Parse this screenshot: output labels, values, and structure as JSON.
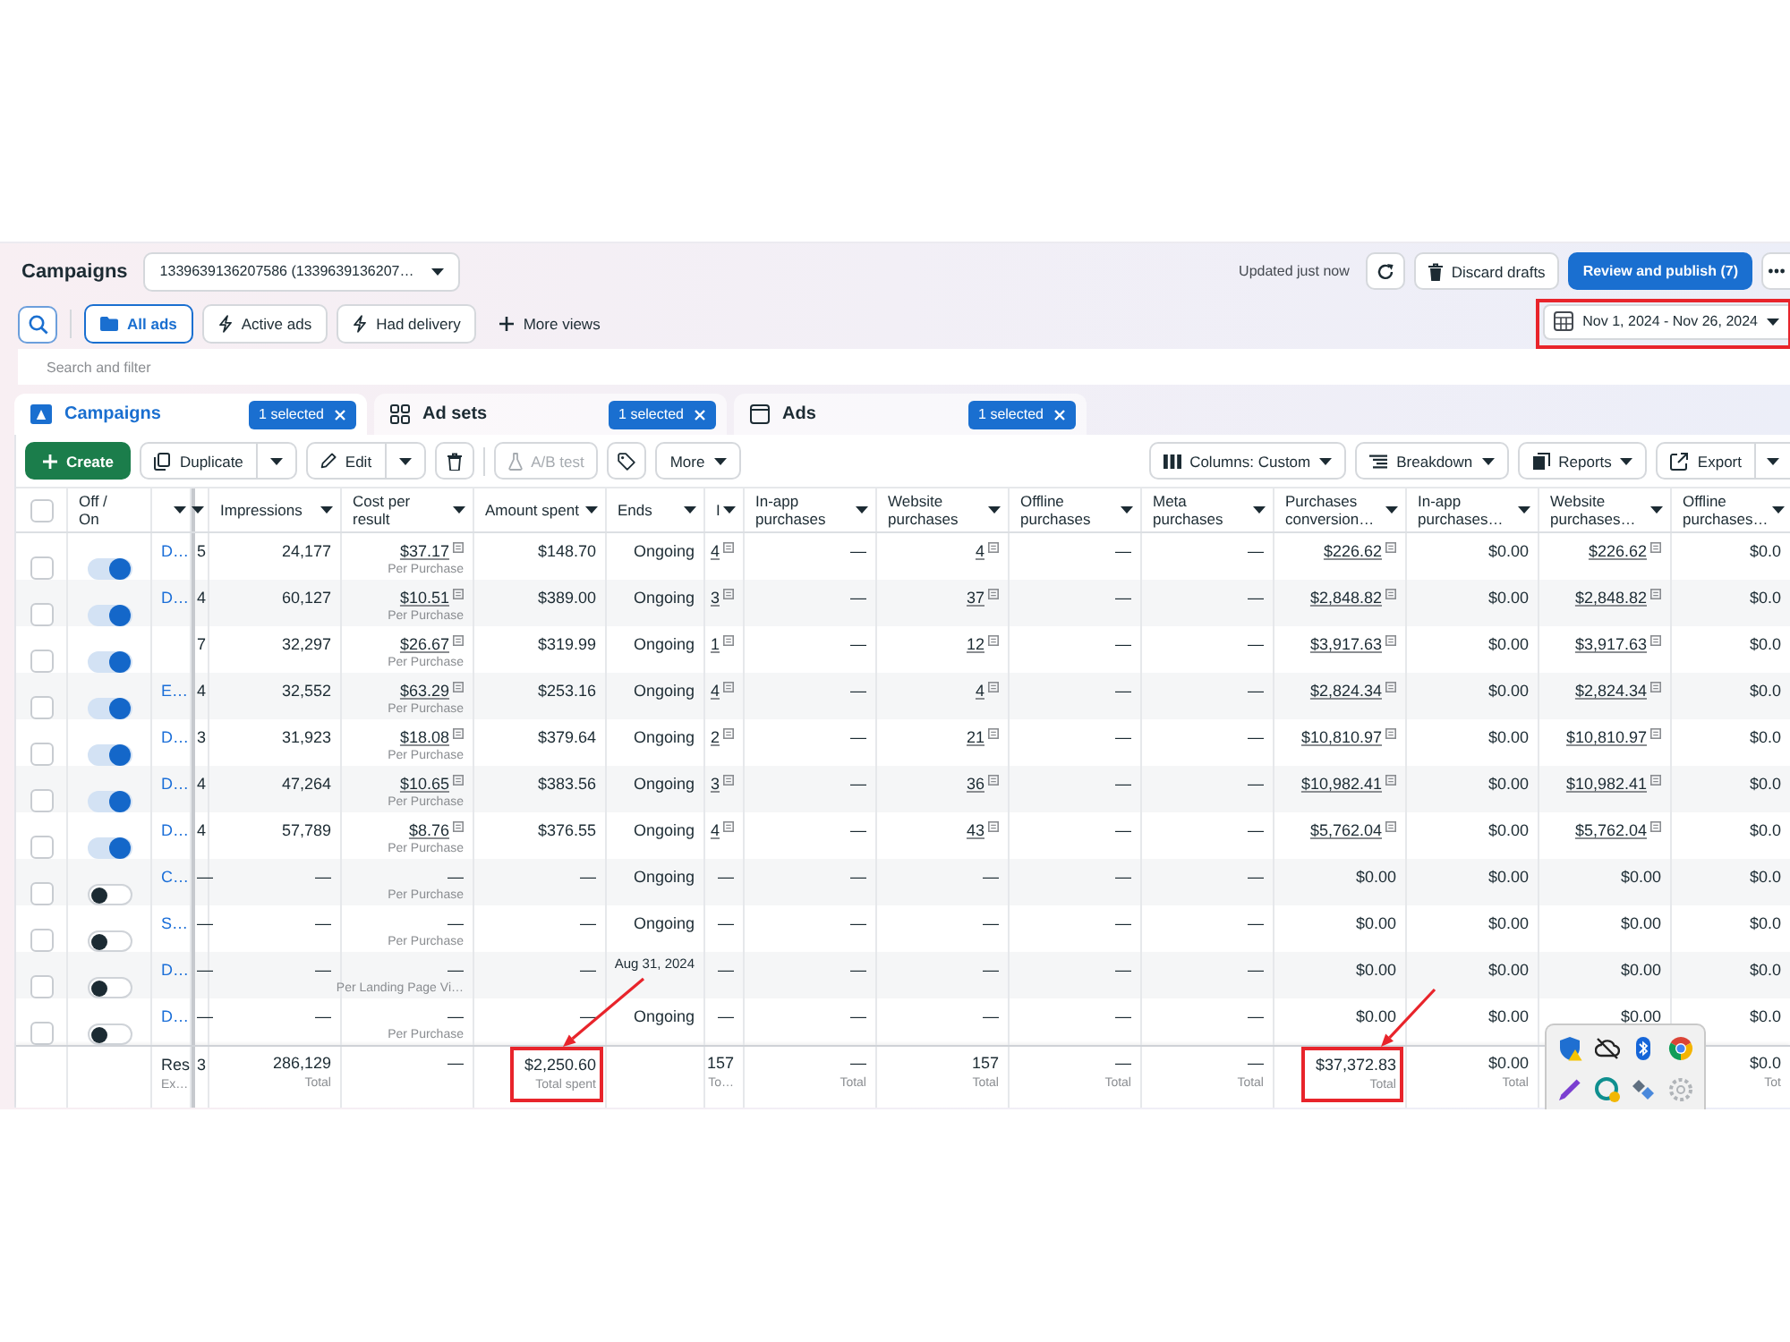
{
  "header": {
    "title": "Campaigns",
    "account": "1339639136207586 (1339639136207…",
    "status": "Updated just now",
    "discard": "Discard drafts",
    "publish": "Review and publish (7)"
  },
  "views": [
    {
      "label": "All ads",
      "kind": "folder",
      "selected": true
    },
    {
      "label": "Active ads",
      "kind": "bolt",
      "selected": false
    },
    {
      "label": "Had delivery",
      "kind": "bolt",
      "selected": false
    }
  ],
  "more_views": "More views",
  "date_range": {
    "label": "Nov 1, 2024 - Nov 26, 2024",
    "highlighted": true
  },
  "search": {
    "placeholder": "Search and filter"
  },
  "tabs": [
    {
      "label": "Campaigns",
      "kind": "campaigns",
      "selected": true,
      "badge": "1 selected"
    },
    {
      "label": "Ad sets",
      "kind": "ad_sets",
      "selected": false,
      "badge": "1 selected"
    },
    {
      "label": "Ads",
      "kind": "ads",
      "selected": false,
      "badge": "1 selected"
    }
  ],
  "toolbar": {
    "create": "Create",
    "duplicate": "Duplicate",
    "edit": "Edit",
    "ab_test": {
      "label": "A/B test",
      "disabled": true
    },
    "more": "More",
    "columns": "Columns: Custom",
    "breakdown": "Breakdown",
    "reports": "Reports",
    "export": "Export"
  },
  "table": {
    "toggle_header": "Off / On",
    "all_checked": false,
    "columns": [
      {
        "kind": "name"
      },
      {
        "kind": "fragment"
      },
      {
        "label": "Impressions",
        "kind": "number",
        "linkable": false
      },
      {
        "label": "Cost per result",
        "kind": "cost",
        "linkable": true
      },
      {
        "label": "Amount spent",
        "kind": "number",
        "linkable": false
      },
      {
        "label": "Ends",
        "kind": "ends"
      },
      {
        "label": "I",
        "kind": "number",
        "linkable": true
      },
      {
        "label": "In-app purchases",
        "kind": "number",
        "linkable": false
      },
      {
        "label": "Website purchases",
        "kind": "number",
        "linkable": true
      },
      {
        "label": "Offline purchases",
        "kind": "number",
        "linkable": false
      },
      {
        "label": "Meta purchases",
        "kind": "number",
        "linkable": false
      },
      {
        "label": "Purchases conversion…",
        "kind": "number",
        "linkable": true
      },
      {
        "label": "In-app purchases…",
        "kind": "number",
        "linkable": false
      },
      {
        "label": "Website purchases…",
        "kind": "number",
        "linkable": true
      },
      {
        "label": "Offline purchases…",
        "kind": "number",
        "linkable": false
      }
    ],
    "rows": [
      {
        "checked": false,
        "on": true,
        "linked": true,
        "cells": [
          "D…",
          "5",
          "24,177",
          {
            "value": "$37.17",
            "label": "Per Purchase"
          },
          "$148.70",
          {
            "text": "Ongoing",
            "kind": "status"
          },
          "4",
          "—",
          "4",
          "—",
          "—",
          "$226.62",
          "$0.00",
          "$226.62",
          "$0.0"
        ]
      },
      {
        "checked": false,
        "on": true,
        "linked": true,
        "cells": [
          "D…",
          "4",
          "60,127",
          {
            "value": "$10.51",
            "label": "Per Purchase"
          },
          "$389.00",
          {
            "text": "Ongoing",
            "kind": "status"
          },
          "3",
          "—",
          "37",
          "—",
          "—",
          "$2,848.82",
          "$0.00",
          "$2,848.82",
          "$0.0"
        ]
      },
      {
        "checked": false,
        "on": true,
        "linked": true,
        "cells": [
          null,
          "7",
          "32,297",
          {
            "value": "$26.67",
            "label": "Per Purchase"
          },
          "$319.99",
          {
            "text": "Ongoing",
            "kind": "status"
          },
          "1",
          "—",
          "12",
          "—",
          "—",
          "$3,917.63",
          "$0.00",
          "$3,917.63",
          "$0.0"
        ]
      },
      {
        "checked": false,
        "on": true,
        "linked": true,
        "cells": [
          "E…",
          "4",
          "32,552",
          {
            "value": "$63.29",
            "label": "Per Purchase"
          },
          "$253.16",
          {
            "text": "Ongoing",
            "kind": "status"
          },
          "4",
          "—",
          "4",
          "—",
          "—",
          "$2,824.34",
          "$0.00",
          "$2,824.34",
          "$0.0"
        ]
      },
      {
        "checked": false,
        "on": true,
        "linked": true,
        "cells": [
          "D…",
          "3",
          "31,923",
          {
            "value": "$18.08",
            "label": "Per Purchase"
          },
          "$379.64",
          {
            "text": "Ongoing",
            "kind": "status"
          },
          "2",
          "—",
          "21",
          "—",
          "—",
          "$10,810.97",
          "$0.00",
          "$10,810.97",
          "$0.0"
        ]
      },
      {
        "checked": false,
        "on": true,
        "linked": true,
        "cells": [
          "D…",
          "4",
          "47,264",
          {
            "value": "$10.65",
            "label": "Per Purchase"
          },
          "$383.56",
          {
            "text": "Ongoing",
            "kind": "status"
          },
          "3",
          "—",
          "36",
          "—",
          "—",
          "$10,982.41",
          "$0.00",
          "$10,982.41",
          "$0.0"
        ]
      },
      {
        "checked": false,
        "on": true,
        "linked": true,
        "cells": [
          "D…",
          "4",
          "57,789",
          {
            "value": "$8.76",
            "label": "Per Purchase"
          },
          "$376.55",
          {
            "text": "Ongoing",
            "kind": "status"
          },
          "4",
          "—",
          "43",
          "—",
          "—",
          "$5,762.04",
          "$0.00",
          "$5,762.04",
          "$0.0"
        ]
      },
      {
        "checked": false,
        "on": false,
        "linked": false,
        "cells": [
          "C…",
          "—",
          "—",
          {
            "value": "—",
            "label": "Per Purchase"
          },
          "—",
          {
            "text": "Ongoing",
            "kind": "status"
          },
          "—",
          "—",
          "—",
          "—",
          "—",
          "$0.00",
          "$0.00",
          "$0.00",
          "$0.0"
        ]
      },
      {
        "checked": false,
        "on": false,
        "linked": false,
        "cells": [
          "S…",
          "—",
          "—",
          {
            "value": "—",
            "label": "Per Purchase"
          },
          "—",
          {
            "text": "Ongoing",
            "kind": "status"
          },
          "—",
          "—",
          "—",
          "—",
          "—",
          "$0.00",
          "$0.00",
          "$0.00",
          "$0.0"
        ]
      },
      {
        "checked": false,
        "on": false,
        "linked": false,
        "cells": [
          "D…",
          "—",
          "—",
          {
            "value": "—",
            "label": "Per Landing Page Vi…"
          },
          "—",
          {
            "text": "Aug 31, 2024",
            "kind": "date"
          },
          "—",
          "—",
          "—",
          "—",
          "—",
          "$0.00",
          "$0.00",
          "$0.00",
          "$0.0"
        ]
      },
      {
        "checked": false,
        "on": false,
        "linked": false,
        "cells": [
          "D…",
          "—",
          "—",
          {
            "value": "—",
            "label": "Per Purchase"
          },
          "—",
          {
            "text": "Ongoing",
            "kind": "status"
          },
          "—",
          "—",
          "—",
          "—",
          "—",
          "$0.00",
          "$0.00",
          "$0.00",
          "$0.0"
        ]
      }
    ],
    "totals": {
      "cells": [
        {
          "text": "Res",
          "label": "Ex…",
          "highlighted": false
        },
        {
          "text": "3",
          "highlighted": false
        },
        {
          "text": "286,129",
          "label": "Total",
          "highlighted": false
        },
        {
          "text": "—",
          "highlighted": false
        },
        {
          "text": "$2,250.60",
          "label": "Total spent",
          "highlighted": true
        },
        null,
        {
          "text": "157",
          "label": "To…",
          "highlighted": false
        },
        {
          "text": "—",
          "label": "Total",
          "highlighted": false
        },
        {
          "text": "157",
          "label": "Total",
          "highlighted": false
        },
        {
          "text": "—",
          "label": "Total",
          "highlighted": false
        },
        {
          "text": "—",
          "label": "Total",
          "highlighted": false
        },
        {
          "text": "$37,372.83",
          "label": "Total",
          "highlighted": true
        },
        {
          "text": "$0.00",
          "label": "Total",
          "highlighted": false
        },
        null,
        {
          "text": "$0.0",
          "label": "Tot",
          "highlighted": false
        }
      ]
    }
  }
}
